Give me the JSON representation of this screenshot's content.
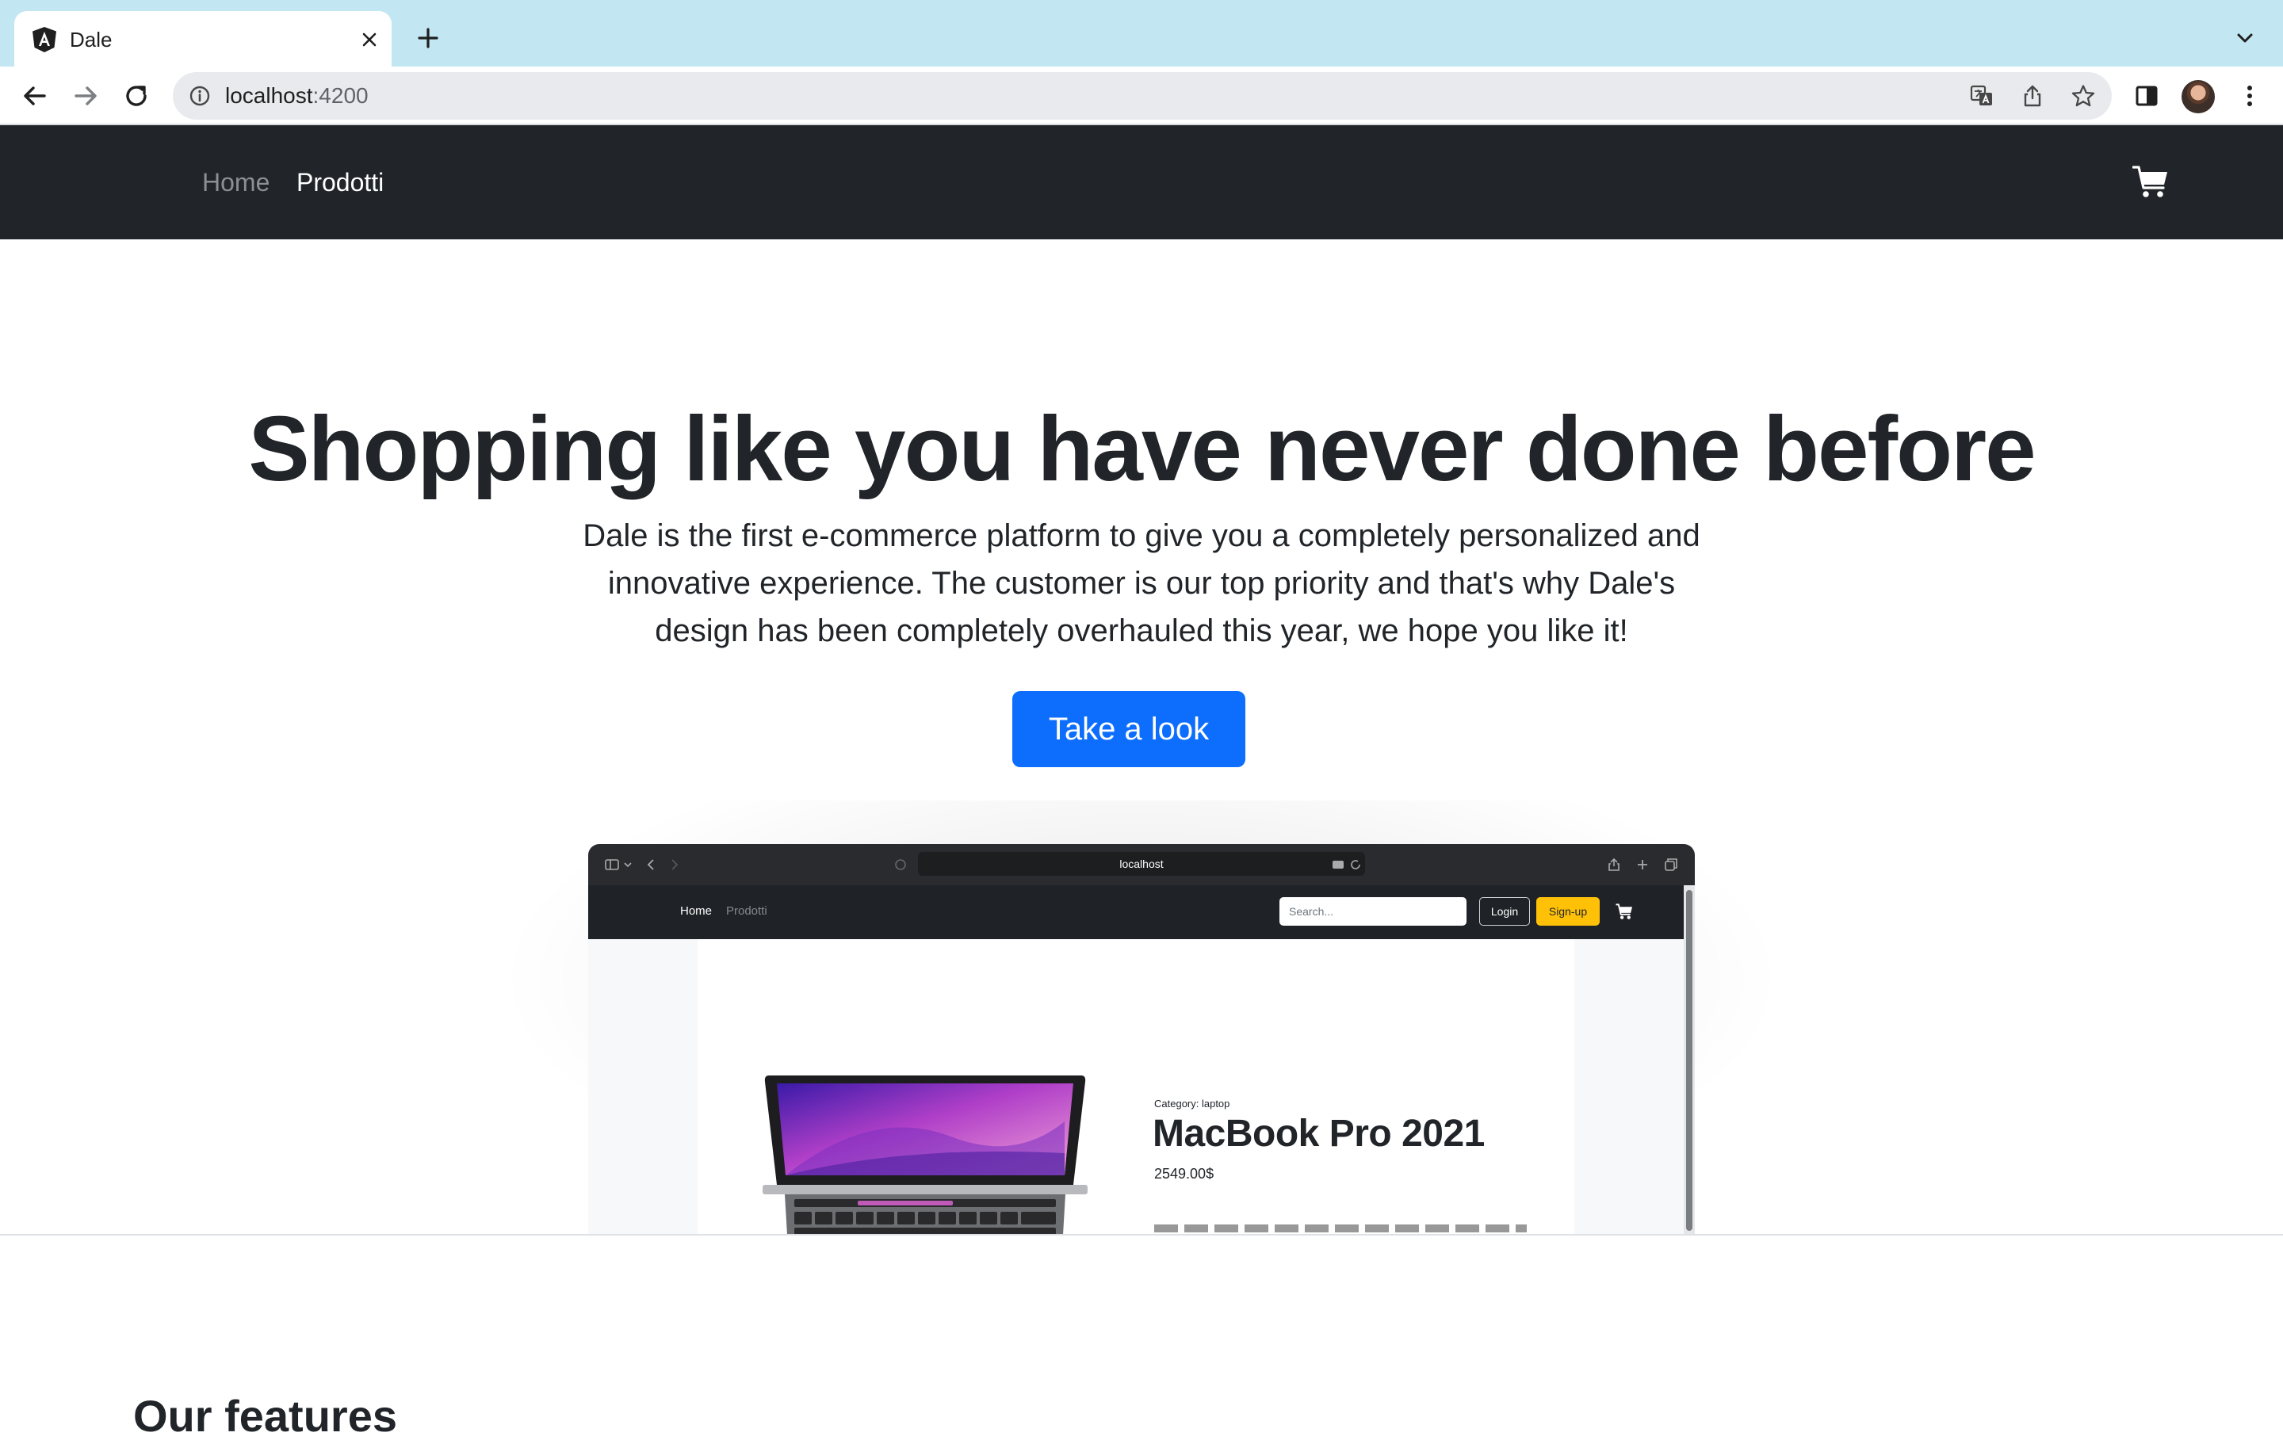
{
  "browser": {
    "tab_title": "Dale",
    "url_host": "localhost",
    "url_port": ":4200"
  },
  "site_nav": {
    "items": [
      {
        "label": "Home",
        "active": false
      },
      {
        "label": "Prodotti",
        "active": true
      }
    ]
  },
  "hero": {
    "title": "Shopping like you have never done before",
    "lead": "Dale is the first e-commerce platform to give you a completely personalized and innovative experience. The customer is our top priority and that's why Dale's design has been completely overhauled this year, we hope you like it!",
    "button": "Take a look"
  },
  "preview": {
    "url": "localhost",
    "nav": {
      "home": "Home",
      "prodotti": "Prodotti"
    },
    "search_placeholder": "Search...",
    "login": "Login",
    "signup": "Sign-up",
    "product": {
      "category": "Category: laptop",
      "name": "MacBook Pro 2021",
      "price": "2549.00$"
    }
  },
  "features": {
    "title": "Our features"
  },
  "colors": {
    "tabstrip": "#c2e7f2",
    "navbar": "#212529",
    "primary": "#0d6efd",
    "warning": "#ffc107"
  }
}
